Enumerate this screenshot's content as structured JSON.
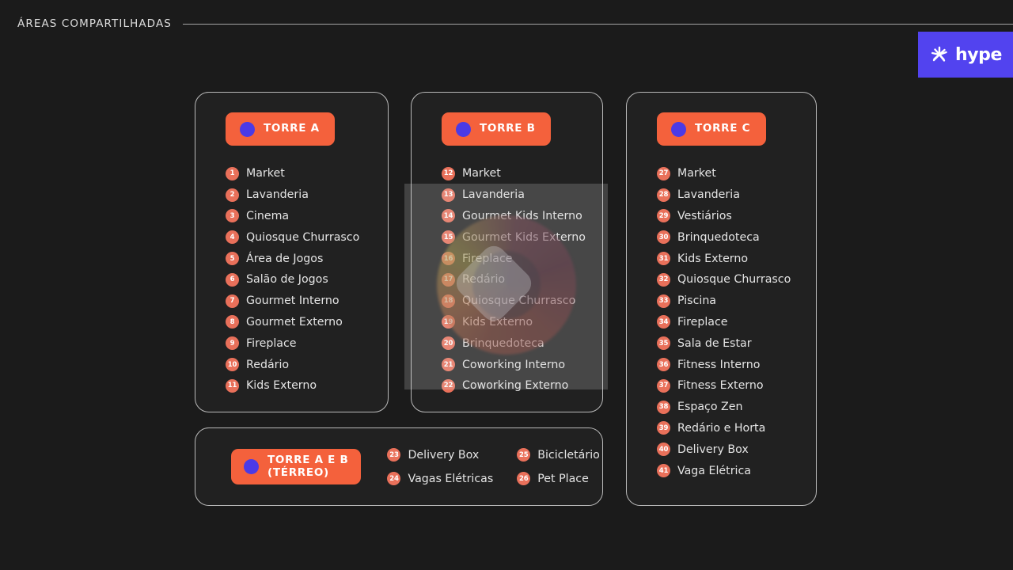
{
  "header": {
    "title": "ÁREAS COMPARTILHADAS"
  },
  "logo": {
    "icon": "hype-pinwheel-icon",
    "word": "hype",
    "background": "#5243ef"
  },
  "colors": {
    "page_background": "#1b1b1b",
    "card_background": "#212121",
    "card_border": "#b9b9b9",
    "badge_orange": "#f4613c",
    "badge_dot_blue": "#4b3ae6",
    "number_circle": "#e9705a",
    "text": "#e4e4e4"
  },
  "towers": [
    {
      "id": "torre-a",
      "badge_label": "TORRE A",
      "items": [
        {
          "num": "1",
          "label": "Market"
        },
        {
          "num": "2",
          "label": "Lavanderia"
        },
        {
          "num": "3",
          "label": "Cinema"
        },
        {
          "num": "4",
          "label": "Quiosque Churrasco"
        },
        {
          "num": "5",
          "label": "Área de Jogos"
        },
        {
          "num": "6",
          "label": "Salão de Jogos"
        },
        {
          "num": "7",
          "label": "Gourmet Interno"
        },
        {
          "num": "8",
          "label": "Gourmet Externo"
        },
        {
          "num": "9",
          "label": "Fireplace"
        },
        {
          "num": "10",
          "label": "Redário"
        },
        {
          "num": "11",
          "label": "Kids Externo"
        }
      ]
    },
    {
      "id": "torre-b",
      "badge_label": "TORRE B",
      "items": [
        {
          "num": "12",
          "label": "Market"
        },
        {
          "num": "13",
          "label": "Lavanderia"
        },
        {
          "num": "14",
          "label": "Gourmet Kids Interno"
        },
        {
          "num": "15",
          "label": "Gourmet Kids Externo"
        },
        {
          "num": "16",
          "label": "Fireplace"
        },
        {
          "num": "17",
          "label": "Redário"
        },
        {
          "num": "18",
          "label": "Quiosque Churrasco"
        },
        {
          "num": "19",
          "label": "Kids Externo"
        },
        {
          "num": "20",
          "label": "Brinquedoteca"
        },
        {
          "num": "21",
          "label": "Coworking Interno"
        },
        {
          "num": "22",
          "label": "Coworking Externo"
        }
      ]
    },
    {
      "id": "torre-c",
      "badge_label": "TORRE C",
      "items": [
        {
          "num": "27",
          "label": "Market"
        },
        {
          "num": "28",
          "label": "Lavanderia"
        },
        {
          "num": "29",
          "label": "Vestiários"
        },
        {
          "num": "30",
          "label": "Brinquedoteca"
        },
        {
          "num": "31",
          "label": "Kids Externo"
        },
        {
          "num": "32",
          "label": "Quiosque Churrasco"
        },
        {
          "num": "33",
          "label": "Piscina"
        },
        {
          "num": "34",
          "label": "Fireplace"
        },
        {
          "num": "35",
          "label": "Sala de Estar"
        },
        {
          "num": "36",
          "label": "Fitness Interno"
        },
        {
          "num": "37",
          "label": "Fitness Externo"
        },
        {
          "num": "38",
          "label": "Espaço Zen"
        },
        {
          "num": "39",
          "label": "Redário e Horta"
        },
        {
          "num": "40",
          "label": "Delivery Box"
        },
        {
          "num": "41",
          "label": "Vaga Elétrica"
        }
      ]
    }
  ],
  "ground_floor": {
    "id": "torre-a-e-b-terreo",
    "badge_label": "TORRE A E B\n(TÉRREO)",
    "column_left": [
      {
        "num": "23",
        "label": "Delivery Box"
      },
      {
        "num": "24",
        "label": "Vagas Elétricas"
      }
    ],
    "column_right": [
      {
        "num": "25",
        "label": "Bicicletário"
      },
      {
        "num": "26",
        "label": "Pet Place"
      }
    ]
  },
  "video_overlay": {
    "control_name": "play-button",
    "visible": true
  }
}
